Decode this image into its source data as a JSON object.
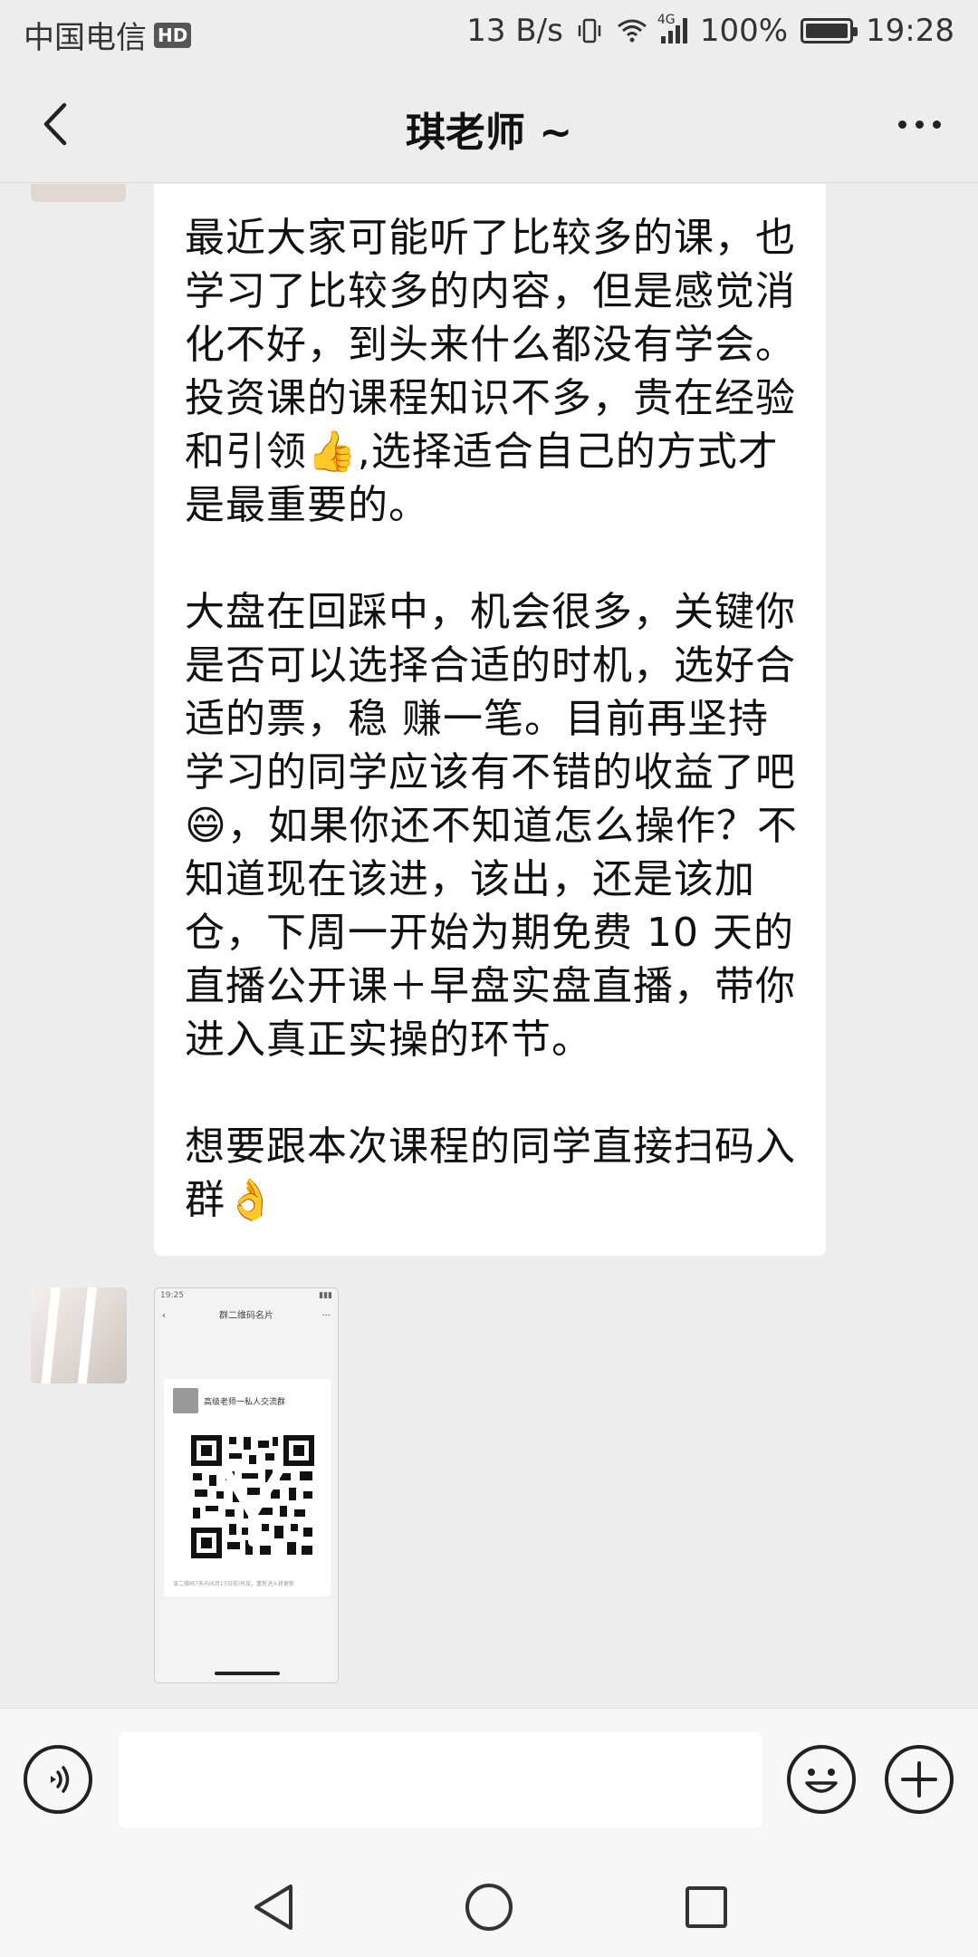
{
  "status_bar": {
    "carrier": "中国电信",
    "hd_badge": "HD",
    "net_speed": "13 B/s",
    "network_type": "4G",
    "battery": "100%",
    "battery_level": 1.0,
    "time": "19:28"
  },
  "nav": {
    "title": "琪老师 ~"
  },
  "messages": {
    "text_message": {
      "paragraphs": [
        "最近大家可能听了比较多的课，也学习了比较多的内容，但是感觉消化不好，到头来什么都没有学会。投资课的课程知识不多，贵在经验和引领👍,选择适合自己的方式才是最重要的。",
        "大盘在回踩中，机会很多，关键你是否可以选择合适的时机，选好合适的票，稳 赚一笔。目前再坚持学习的同学应该有不错的收益了吧😄，如果你还不知道怎么操作？不知道现在该进，该出，还是该加仓，下周一开始为期免费 10 天的直播公开课＋早盘实盘直播，带你进入真正实操的环节。",
        "想要跟本次课程的同学直接扫码入群👌"
      ]
    },
    "image_message": {
      "mini_time": "19:25",
      "mini_title": "群二维码名片",
      "group_name": "高级老师一私人交流群",
      "footer": "该二维码7天内(6月17日前)有效，重新进入将更新"
    }
  },
  "input_bar": {
    "placeholder": "",
    "voice_icon": "voice-icon",
    "emoji_icon": "emoji-icon",
    "plus_icon": "plus-icon"
  },
  "system_nav": {
    "back": "back-triangle-icon",
    "home": "home-circle-icon",
    "recents": "recents-square-icon"
  }
}
